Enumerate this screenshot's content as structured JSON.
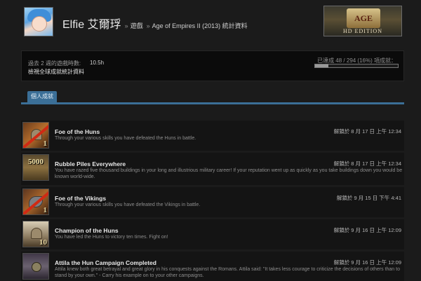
{
  "header": {
    "persona_name": "Elfie 艾爾琈",
    "sep1": "»",
    "crumb_games": "遊戲",
    "sep2": "»",
    "crumb_stats": "Age of Empires II (2013) 統計資料",
    "logo_emblem": "AGE",
    "logo_text": "HD EDITION"
  },
  "summary": {
    "playtime_label": "過去 2 週的遊戲時數:",
    "playtime_value": "10.5h",
    "global_link": "檢視全球成就統計資料",
    "progress_text": "已達成 48 / 294 (16%) 項成就：",
    "progress_fraction": 0.16
  },
  "tabs": [
    {
      "label": "個人成就"
    }
  ],
  "achievements": [
    {
      "title": "Foe of the Huns",
      "description": "Through your various skills you have defeated the Huns in battle.",
      "date": "解鎖於 8 月 17 日 上午 12:34",
      "icon_label": "1"
    },
    {
      "title": "Rubble Piles Everywhere",
      "description": "You have razed five thousand buildings in your long and illustrious military career! If your reputation went up as quickly as you take buildings down you would be known world-wide.",
      "date": "解鎖於 8 月 17 日 上午 12:34",
      "icon_label": "5000"
    },
    {
      "title": "Foe of the Vikings",
      "description": "Through your various skills you have defeated the Vikings in battle.",
      "date": "解鎖於 9 月 15 日 下午 4:41",
      "icon_label": "1"
    },
    {
      "title": "Champion of the Huns",
      "description": "You have led the Huns to victory ten times. Fight on!",
      "date": "解鎖於 9 月 16 日 上午 12:09",
      "icon_label": "10"
    },
    {
      "title": "Attila the Hun Campaign Completed",
      "description": "Attila knew both great betrayal and great glory in his conquests against the Romans. Attila said: \"It takes less courage to criticize the decisions of others than to stand by your own.\" - Carry his example on to your other campaigns.",
      "date": "解鎖於 9 月 16 日 上午 12:09",
      "icon_label": ""
    }
  ]
}
